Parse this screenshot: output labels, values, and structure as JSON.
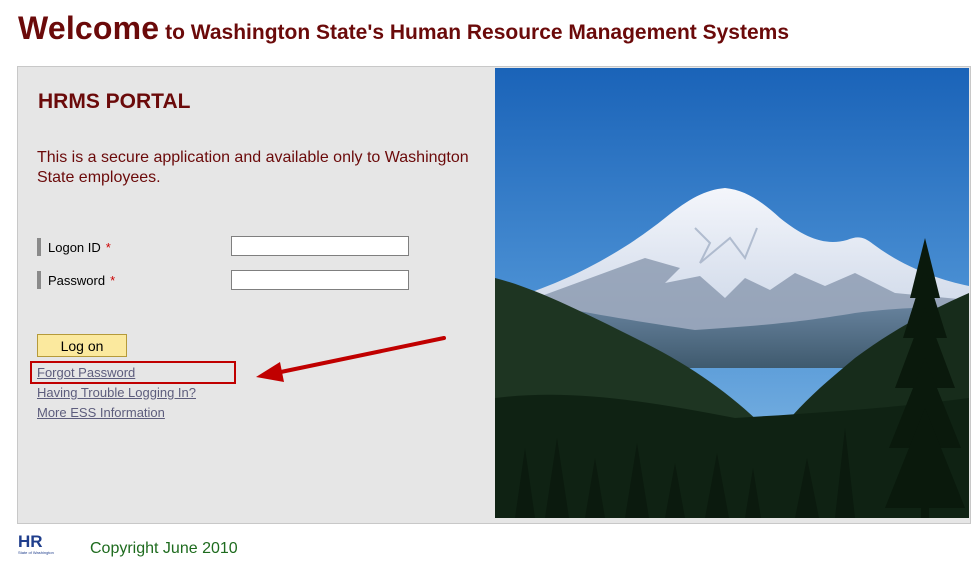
{
  "header": {
    "welcome": "Welcome",
    "title_rest": " to Washington State's Human Resource Management Systems"
  },
  "portal": {
    "title": "HRMS PORTAL",
    "intro": "This is a secure application and available only to Washington State employees."
  },
  "form": {
    "logon_label": "Logon ID",
    "password_label": "Password",
    "required_mark": "*",
    "logon_value": "",
    "password_value": "",
    "logon_button": "Log on"
  },
  "links": {
    "forgot_password": "Forgot Password",
    "trouble": "Having Trouble Logging In?",
    "more_info": "More ESS Information"
  },
  "footer": {
    "logo_text": "HR",
    "logo_sub": "State of Washington",
    "copyright": "Copyright June 2010"
  },
  "colors": {
    "title": "#6b0a0a",
    "button": "#fbe99e",
    "annotation": "#c00000",
    "copyright": "#1e6b1e"
  }
}
